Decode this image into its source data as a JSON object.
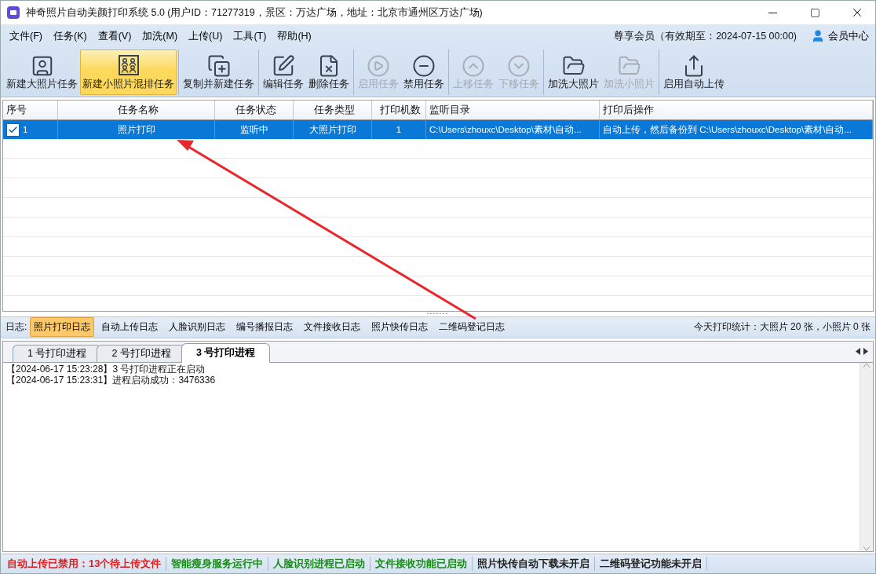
{
  "window": {
    "title": "神奇照片自动美颜打印系统 5.0 (用户ID：71277319，景区：万达广场，地址：北京市通州区万达广场)"
  },
  "menu": [
    "文件(F)",
    "任务(K)",
    "查看(V)",
    "加洗(M)",
    "上传(U)",
    "工具(T)",
    "帮助(H)"
  ],
  "membership": {
    "text": "尊享会员（有效期至：2024-07-15 00:00)",
    "link": "会员中心"
  },
  "toolbar": [
    {
      "items": [
        {
          "kind": "person",
          "label": "新建大照片任务",
          "disabled": false,
          "selected": false
        },
        {
          "kind": "group",
          "label": "新建小照片混排任务",
          "disabled": false,
          "selected": true
        }
      ]
    },
    {
      "items": [
        {
          "kind": "copy",
          "label": "复制并新建任务",
          "disabled": false,
          "selected": false
        }
      ]
    },
    {
      "items": [
        {
          "kind": "edit",
          "label": "编辑任务",
          "disabled": false,
          "selected": false
        },
        {
          "kind": "delete",
          "label": "删除任务",
          "disabled": false,
          "selected": false
        }
      ]
    },
    {
      "items": [
        {
          "kind": "play",
          "label": "启用任务",
          "disabled": true,
          "selected": false
        },
        {
          "kind": "minus",
          "label": "禁用任务",
          "disabled": false,
          "selected": false
        }
      ]
    },
    {
      "items": [
        {
          "kind": "up",
          "label": "上移任务",
          "disabled": true,
          "selected": false
        },
        {
          "kind": "down",
          "label": "下移任务",
          "disabled": true,
          "selected": false
        }
      ]
    },
    {
      "items": [
        {
          "kind": "folder",
          "label": "加洗大照片",
          "disabled": false,
          "selected": false
        },
        {
          "kind": "folder",
          "label": "加洗小照片",
          "disabled": true,
          "selected": false
        }
      ]
    },
    {
      "items": [
        {
          "kind": "upload",
          "label": "启用自动上传",
          "disabled": false,
          "selected": false
        }
      ]
    }
  ],
  "table": {
    "columns": [
      "序号",
      "任务名称",
      "任务状态",
      "任务类型",
      "打印机数",
      "监听目录",
      "打印后操作"
    ],
    "rows": [
      {
        "checked": true,
        "selected": true,
        "cells": [
          "1",
          "照片打印",
          "监听中",
          "大照片打印",
          "1",
          "C:\\Users\\zhouxc\\Desktop\\素材\\自动...",
          "自动上传，然后备份到 C:\\Users\\zhouxc\\Desktop\\素材\\自动..."
        ]
      }
    ]
  },
  "log_bar": {
    "label": "日志:",
    "tabs": [
      {
        "label": "照片打印日志",
        "selected": true
      },
      {
        "label": "自动上传日志",
        "selected": false
      },
      {
        "label": "人脸识别日志",
        "selected": false
      },
      {
        "label": "编号播报日志",
        "selected": false
      },
      {
        "label": "文件接收日志",
        "selected": false
      },
      {
        "label": "照片快传日志",
        "selected": false
      },
      {
        "label": "二维码登记日志",
        "selected": false
      }
    ],
    "stats": "今天打印统计：大照片 20 张，小照片 0 张"
  },
  "process_tabs": [
    {
      "label": "1 号打印进程",
      "selected": false
    },
    {
      "label": "2 号打印进程",
      "selected": false
    },
    {
      "label": "3 号打印进程",
      "selected": true
    }
  ],
  "log_lines": [
    "【2024-06-17 15:23:28】3 号打印进程正在启动",
    "【2024-06-17 15:23:31】进程启动成功：3476336"
  ],
  "status_bar": [
    {
      "text": "自动上传已禁用：13个待上传文件",
      "color": "#e02020"
    },
    {
      "text": "智能瘦身服务运行中",
      "color": "#1a8a1a"
    },
    {
      "text": "人脸识别进程已启动",
      "color": "#1a8a1a"
    },
    {
      "text": "文件接收功能已启动",
      "color": "#1a8a1a"
    },
    {
      "text": "照片快传自动下载未开启",
      "color": "#202020"
    },
    {
      "text": "二维码登记功能未开启",
      "color": "#202020"
    }
  ]
}
